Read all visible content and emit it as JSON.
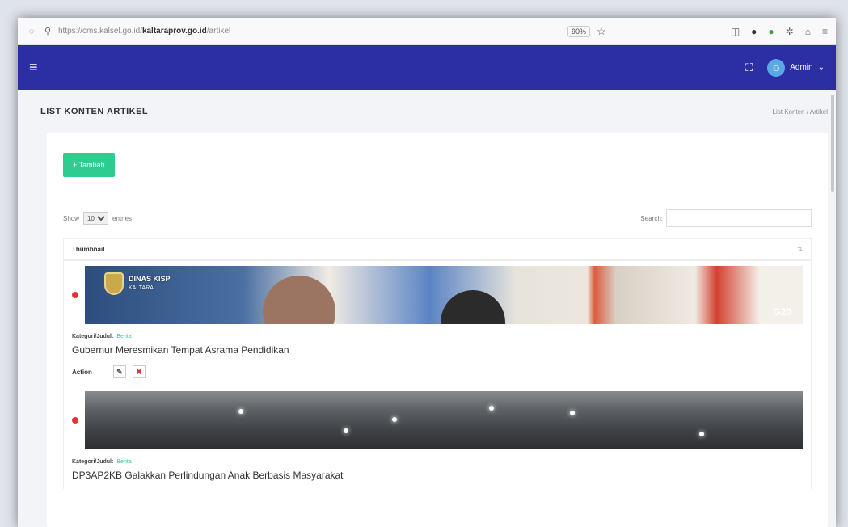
{
  "browser": {
    "url_prefix": "https://cms.kalsel.go.id/",
    "url_domain": "kaltaraprov.go.id",
    "url_path": "/artikel",
    "zoom": "90%"
  },
  "topbar": {
    "user": "Admin"
  },
  "page": {
    "title": "LIST KONTEN ARTIKEL",
    "breadcrumb": "List Konten / Artikel"
  },
  "card": {
    "add_button": "+ Tambah",
    "show_label": "Show",
    "show_value": "10",
    "entries_label": "entries",
    "search_label": "Search:",
    "column_header": "Thumbnail",
    "thumb1_logo_title": "DINAS KISP",
    "thumb1_logo_sub": "KALTARA",
    "thumb1_badge": "G20"
  },
  "articles": [
    {
      "category_label": "Kategori/Judul:",
      "category": "Berita",
      "title": "Gubernur Meresmikan Tempat Asrama Pendidikan",
      "action_label": "Action"
    },
    {
      "category_label": "Kategori/Judul:",
      "category": "Berita",
      "title": "DP3AP2KB Galakkan Perlindungan Anak Berbasis Masyarakat"
    }
  ],
  "colors": {
    "navbar": "#2b2fa3",
    "accent": "#2ecc8f",
    "danger": "#e03535"
  }
}
